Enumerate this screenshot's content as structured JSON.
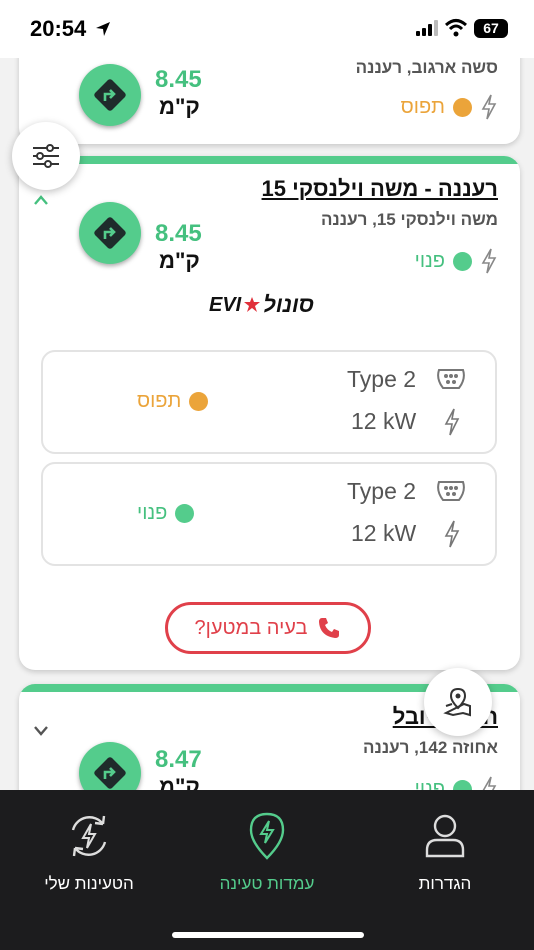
{
  "status_bar": {
    "time": "20:54",
    "battery": "67"
  },
  "colors": {
    "accent": "#54cc8c",
    "occupied": "#eba43a",
    "available": "#54cc8c",
    "danger": "#e0404a",
    "nav_bg": "#1c1c1e"
  },
  "cards": [
    {
      "title": "",
      "address": "סשה ארגוב, רעננה",
      "status": "תפוס",
      "status_color": "occupied",
      "distance": "8.45",
      "unit": "ק\"מ"
    },
    {
      "title": "רעננה - משה וילנסקי 15",
      "address": "משה וילנסקי 15, רעננה",
      "status": "פנוי",
      "status_color": "available",
      "distance": "8.45",
      "unit": "ק\"מ",
      "brand_latin": "EVI",
      "brand_hebrew": "סונול",
      "connectors": [
        {
          "type": "Type 2",
          "power": "12 kW",
          "status": "תפוס",
          "status_color": "occupied"
        },
        {
          "type": "Type 2",
          "power": "12 kW",
          "status": "פנוי",
          "status_color": "available"
        }
      ],
      "issue_button": "בעיה במטען?"
    },
    {
      "title": "חניון היובל",
      "address": "אחוזה 142, רעננה",
      "status": "פנוי",
      "status_color": "available",
      "distance": "8.47",
      "unit": "ק\"מ"
    }
  ],
  "icons": {
    "filter": "sliders-icon",
    "map": "map-pin-icon",
    "navigate": "turn-right-arrow-icon",
    "bolt": "lightning-icon",
    "plug": "type2-plug-icon",
    "phone": "phone-icon"
  },
  "bottom_nav": [
    {
      "label": "הטעינות שלי",
      "icon": "charging-history-icon",
      "active": false
    },
    {
      "label": "עמדות טעינה",
      "icon": "charging-station-pin-icon",
      "active": true
    },
    {
      "label": "הגדרות",
      "icon": "user-icon",
      "active": false
    }
  ]
}
